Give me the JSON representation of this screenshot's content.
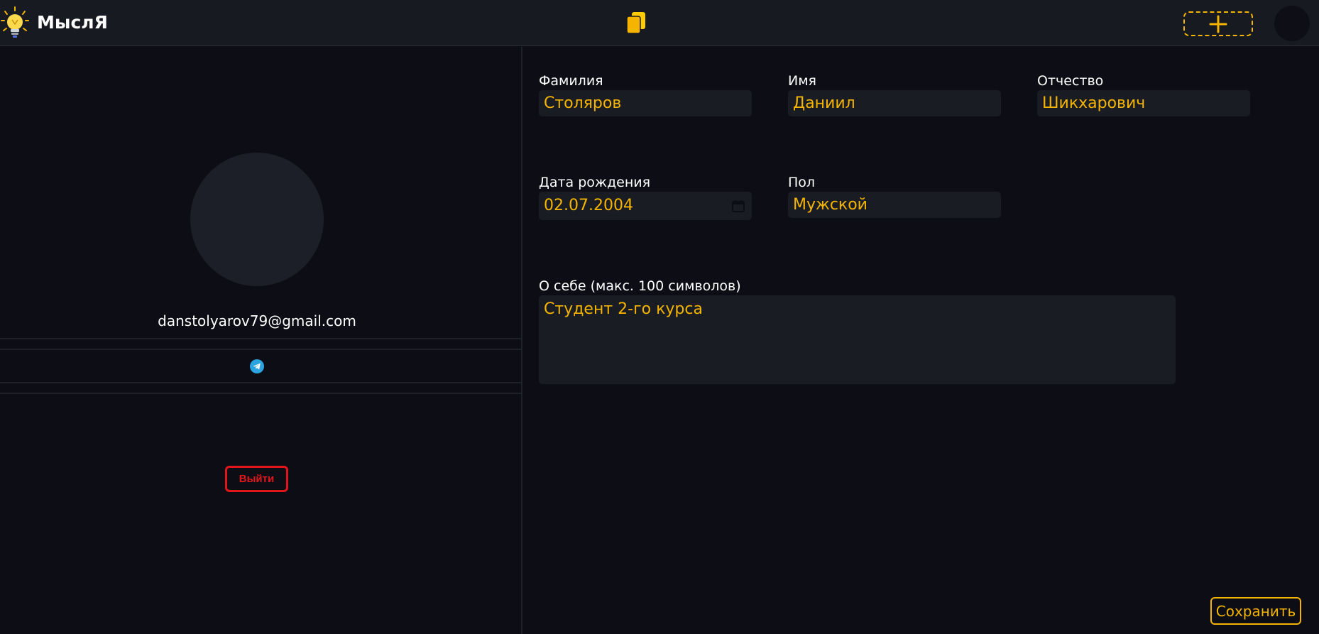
{
  "header": {
    "app_name": "МыслЯ",
    "icons": {
      "logo": "lightbulb-icon",
      "center": "cards-icon",
      "add": "plus-icon"
    },
    "accent_color": "#f4b400"
  },
  "profile": {
    "email": "danstolyarov79@gmail.com",
    "social_icon": "telegram-icon",
    "logout_label": "Выйти",
    "logout_color": "#e0161b"
  },
  "form": {
    "last_name": {
      "label": "Фамилия",
      "value": "Столяров"
    },
    "first_name": {
      "label": "Имя",
      "value": "Даниил"
    },
    "patronymic": {
      "label": "Отчество",
      "value": "Шикхарович"
    },
    "birth_date": {
      "label": "Дата рождения",
      "value": "02.07.2004"
    },
    "gender": {
      "label": "Пол",
      "value": "Мужской"
    },
    "about": {
      "label": "О себе (макс. 100 символов)",
      "value": "Студент 2-го курса"
    },
    "save_label": "Сохранить"
  }
}
